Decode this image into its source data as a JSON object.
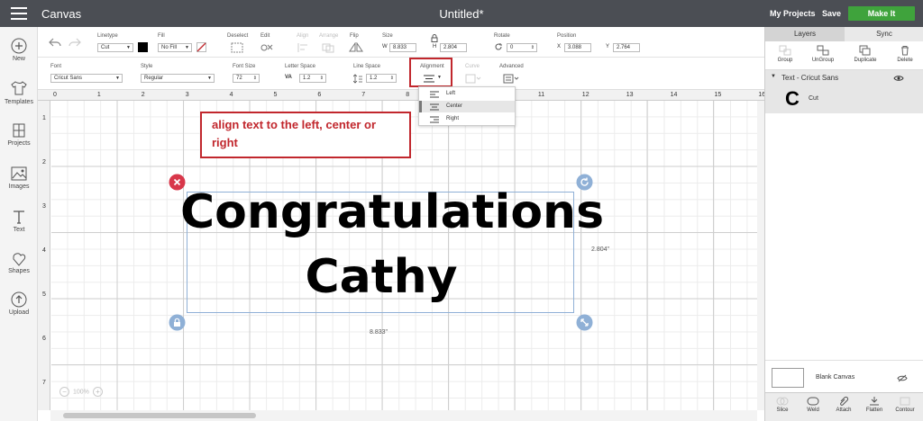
{
  "header": {
    "app_title": "Canvas",
    "doc_title": "Untitled*",
    "my_projects": "My Projects",
    "save": "Save",
    "make_it": "Make It"
  },
  "sidebar": {
    "items": [
      {
        "label": "New",
        "icon": "plus-circle-icon"
      },
      {
        "label": "Templates",
        "icon": "shirt-icon"
      },
      {
        "label": "Projects",
        "icon": "projects-icon"
      },
      {
        "label": "Images",
        "icon": "image-icon"
      },
      {
        "label": "Text",
        "icon": "text-icon"
      },
      {
        "label": "Shapes",
        "icon": "shapes-icon"
      },
      {
        "label": "Upload",
        "icon": "upload-icon"
      }
    ]
  },
  "toolbar": {
    "linetype_label": "Linetype",
    "linetype_value": "Cut",
    "fill_label": "Fill",
    "fill_value": "No Fill",
    "deselect": "Deselect",
    "edit": "Edit",
    "align": "Align",
    "arrange": "Arrange",
    "flip": "Flip",
    "size_label": "Size",
    "size_w_label": "W",
    "size_w": "8.833",
    "size_h_label": "H",
    "size_h": "2.804",
    "rotate_label": "Rotate",
    "rotate_value": "0",
    "position_label": "Position",
    "pos_x_label": "X",
    "pos_x": "3.088",
    "pos_y_label": "Y",
    "pos_y": "2.764"
  },
  "text_toolbar": {
    "font_label": "Font",
    "font_value": "Cricut Sans",
    "style_label": "Style",
    "style_value": "Regular",
    "font_size_label": "Font Size",
    "font_size_value": "72",
    "letter_space_label": "Letter Space",
    "letter_space_value": "1.2",
    "line_space_label": "Line Space",
    "line_space_value": "1.2",
    "alignment_label": "Alignment",
    "curve_label": "Curve",
    "advanced_label": "Advanced"
  },
  "alignment_menu": {
    "options": [
      "Left",
      "Center",
      "Right"
    ],
    "selected": "Center"
  },
  "canvas": {
    "ruler_top": [
      "0",
      "1",
      "2",
      "3",
      "4",
      "5",
      "6",
      "7",
      "8",
      "9",
      "10",
      "11",
      "12",
      "13",
      "14",
      "15",
      "16"
    ],
    "ruler_left": [
      "1",
      "2",
      "3",
      "4",
      "5",
      "6",
      "7"
    ],
    "annotation": "align text to the left, center or right",
    "text_line1": "Congratulations",
    "text_line2": "Cathy",
    "height_dim": "2.804\"",
    "width_dim": "8.833\"",
    "zoom": "100%"
  },
  "right_panel": {
    "tabs": [
      "Layers",
      "Sync"
    ],
    "actions": [
      "Group",
      "UnGroup",
      "Duplicate",
      "Delete"
    ],
    "layer_group": "Text - Cricut Sans",
    "layer_item_glyph": "C",
    "layer_item_label": "Cut",
    "blank_canvas": "Blank Canvas",
    "bottom_actions": [
      "Slice",
      "Weld",
      "Attach",
      "Flatten",
      "Contour"
    ]
  },
  "colors": {
    "topbar": "#4b4e54",
    "make_it": "#3fa33c",
    "annotation_red": "#c1272d",
    "delete_red": "#c1272d",
    "handle_blue": "#8fb0d6"
  }
}
